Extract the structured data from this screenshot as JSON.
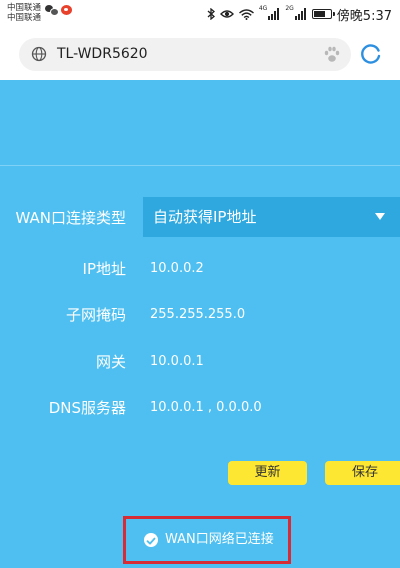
{
  "status_bar": {
    "carrier1": "中国联通",
    "carrier2": "中国联通",
    "net_label_1": "4G",
    "net_label_2": "2G",
    "battery_level": 0.75,
    "time": "傍晚5:37",
    "icons": [
      "wechat-icon",
      "weibo-icon",
      "bluetooth-icon",
      "eye-icon",
      "wifi-icon",
      "signal-icon",
      "signal-icon",
      "battery-icon"
    ]
  },
  "browser": {
    "url": "TL-WDR5620",
    "icons": [
      "globe-icon",
      "paw-icon",
      "reload-icon"
    ]
  },
  "form": {
    "wan_type_label": "WAN口连接类型",
    "wan_type_value": "自动获得IP地址",
    "ip_label": "IP地址",
    "ip_value": "10.0.0.2",
    "mask_label": "子网掩码",
    "mask_value": "255.255.255.0",
    "gateway_label": "网关",
    "gateway_value": "10.0.0.1",
    "dns_label": "DNS服务器",
    "dns_value": "10.0.0.1 , 0.0.0.0"
  },
  "buttons": {
    "refresh": "更新",
    "save": "保存"
  },
  "connection_status": "WAN口网络已连接",
  "colors": {
    "background": "#4ebff0",
    "select_background": "#2ea8df",
    "button": "#fde732",
    "highlight_border": "#d72b35"
  }
}
